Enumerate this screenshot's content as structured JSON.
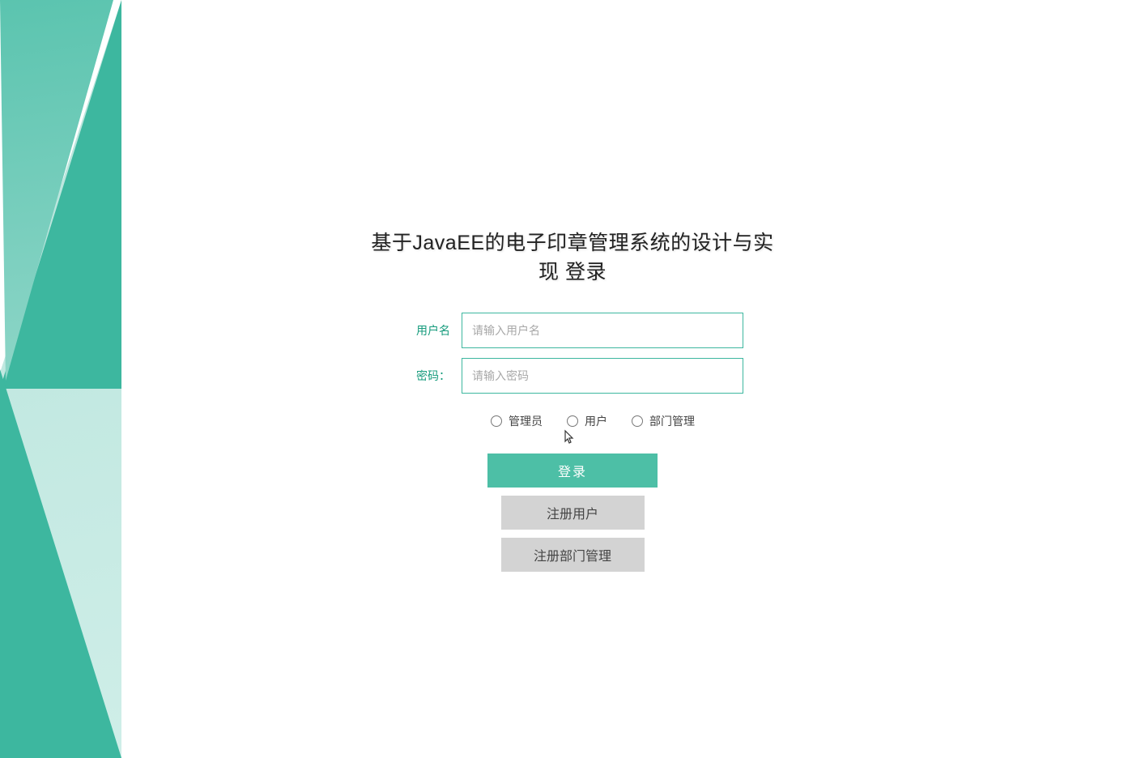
{
  "title": "基于JavaEE的电子印章管理系统的设计与实现 登录",
  "form": {
    "username_label": "用户名",
    "username_placeholder": "请输入用户名",
    "password_label": "密码：",
    "password_placeholder": "请输入密码"
  },
  "roles": [
    {
      "label": "管理员"
    },
    {
      "label": "用户"
    },
    {
      "label": "部门管理"
    }
  ],
  "buttons": {
    "login": "登录",
    "register_user": "注册用户",
    "register_dept": "注册部门管理"
  }
}
